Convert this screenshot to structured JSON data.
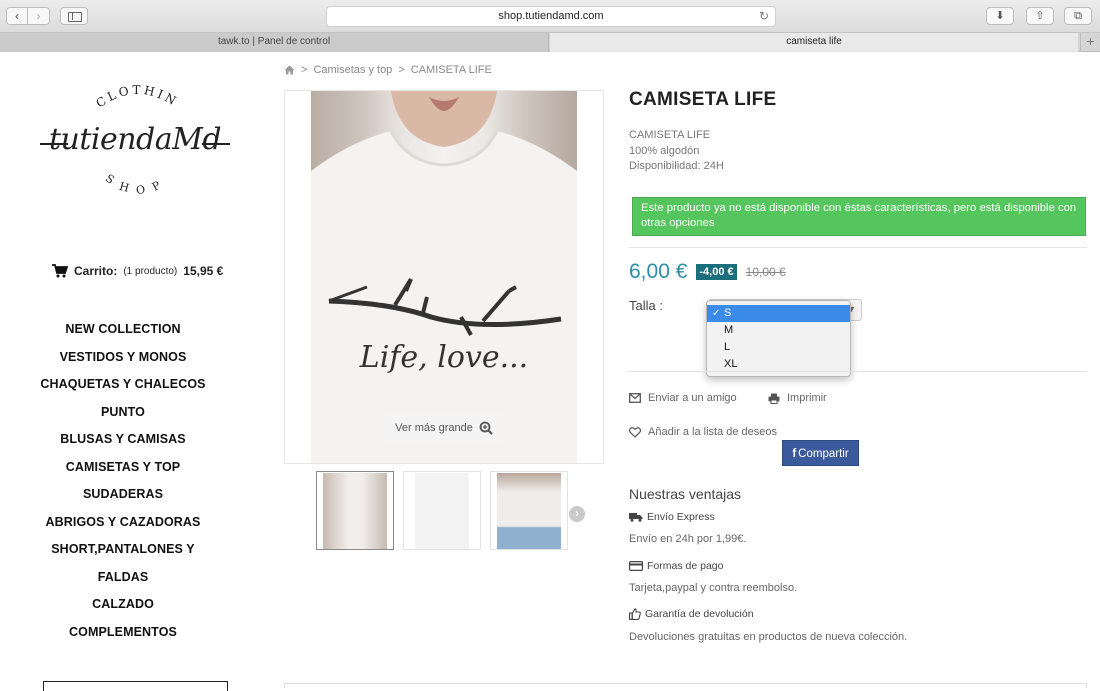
{
  "browser": {
    "url": "shop.tutiendamd.com",
    "tabs": [
      {
        "label": "tawk.to | Panel de control"
      },
      {
        "label": "camiseta life"
      }
    ]
  },
  "logo": {
    "top": "CLOTHING",
    "main": "tutiendaMd",
    "bottom": "SHOP"
  },
  "cart": {
    "label": "Carrito:",
    "count": "(1 producto)",
    "total": "15,95 €"
  },
  "categories": [
    "NEW COLLECTION",
    "VESTIDOS Y MONOS",
    "CHAQUETAS Y CHALECOS",
    "PUNTO",
    "BLUSAS Y CAMISAS",
    "CAMISETAS Y TOP",
    "SUDADERAS",
    "ABRIGOS Y CAZADORAS",
    "SHORT,PANTALONES Y",
    "FALDAS",
    "CALZADO",
    "COMPLEMENTOS"
  ],
  "breadcrumb": {
    "separator": ">",
    "category": "Camisetas y top",
    "current": "CAMISETA LIFE"
  },
  "image": {
    "zoom_label": "Ver más grande",
    "print_text": "Life, love..."
  },
  "product": {
    "title": "CAMISETA LIFE",
    "desc_name": "CAMISETA LIFE",
    "desc_material": "100% algodón",
    "desc_availability": "Disponibilidad: 24H",
    "alert": "Este producto ya no está disponible con éstas características, pero está disponible con otras opciones",
    "price": "6,00 €",
    "discount": "-4,00 €",
    "old_price": "10,00 €",
    "size_label": "Talla :",
    "sizes": [
      "S",
      "M",
      "L",
      "XL"
    ],
    "selected_size": "S"
  },
  "actions": {
    "send_friend": "Enviar a un amigo",
    "print": "Imprimir",
    "wishlist": "Añadir a la lista de deseos",
    "share": "Compartir"
  },
  "advantages": {
    "title": "Nuestras ventajas",
    "shipping_head": "Envío Express",
    "shipping_text": "Envío en 24h por 1,99€.",
    "payment_head": "Formas de pago",
    "payment_text": "Tarjeta,paypal y contra reembolso.",
    "returns_head": "Garantía de devolución",
    "returns_text": "Devoluciones gratuitas en productos de nueva colección."
  },
  "colors": {
    "price": "#2b8eab",
    "alert": "#55c65e",
    "discount": "#1b6e7c",
    "share": "#3b5a9b"
  }
}
